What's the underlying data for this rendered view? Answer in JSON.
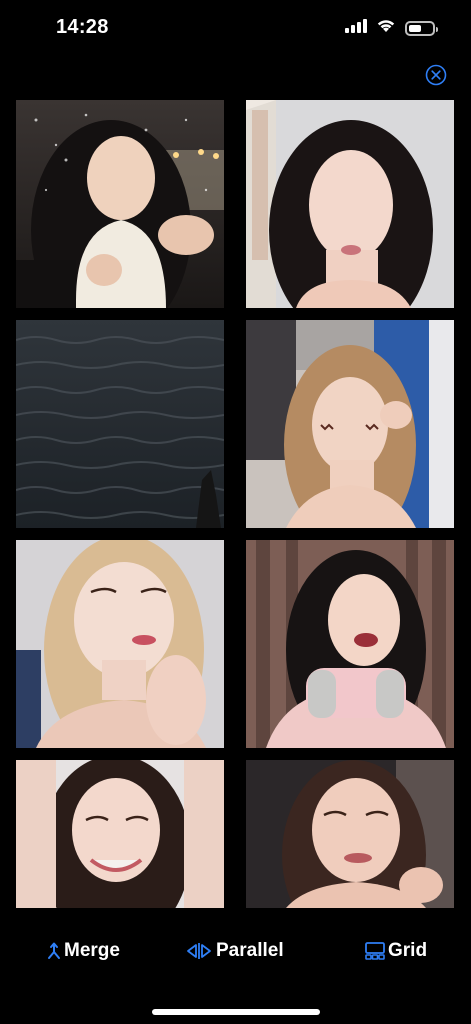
{
  "status_bar": {
    "time": "14:28",
    "signal_icon": "cellular-signal-icon",
    "wifi_icon": "wifi-icon",
    "battery_icon": "battery-icon",
    "battery_level": 0.55
  },
  "close_icon": "close-circle-icon",
  "accent_color": "#2f7ff6",
  "tiles": [
    {
      "description": "video-thumbnail",
      "scene": "woman in snow with white scarf"
    },
    {
      "description": "video-thumbnail",
      "scene": "woman with long dark hair, eyes closed"
    },
    {
      "description": "video-thumbnail",
      "scene": "dark sea water"
    },
    {
      "description": "video-thumbnail",
      "scene": "woman with decorated cheeks"
    },
    {
      "description": "video-thumbnail",
      "scene": "blonde woman posing with hands"
    },
    {
      "description": "video-thumbnail",
      "scene": "woman with pink headphones"
    },
    {
      "description": "video-thumbnail",
      "scene": "smiling woman, arms up"
    },
    {
      "description": "video-thumbnail",
      "scene": "smiling woman, dark hair"
    }
  ],
  "toolbar": {
    "merge_label": "Merge",
    "merge_icon": "merge-icon",
    "parallel_label": "Parallel",
    "parallel_icon": "parallel-icon",
    "grid_label": "Grid",
    "grid_icon": "grid-icon"
  }
}
